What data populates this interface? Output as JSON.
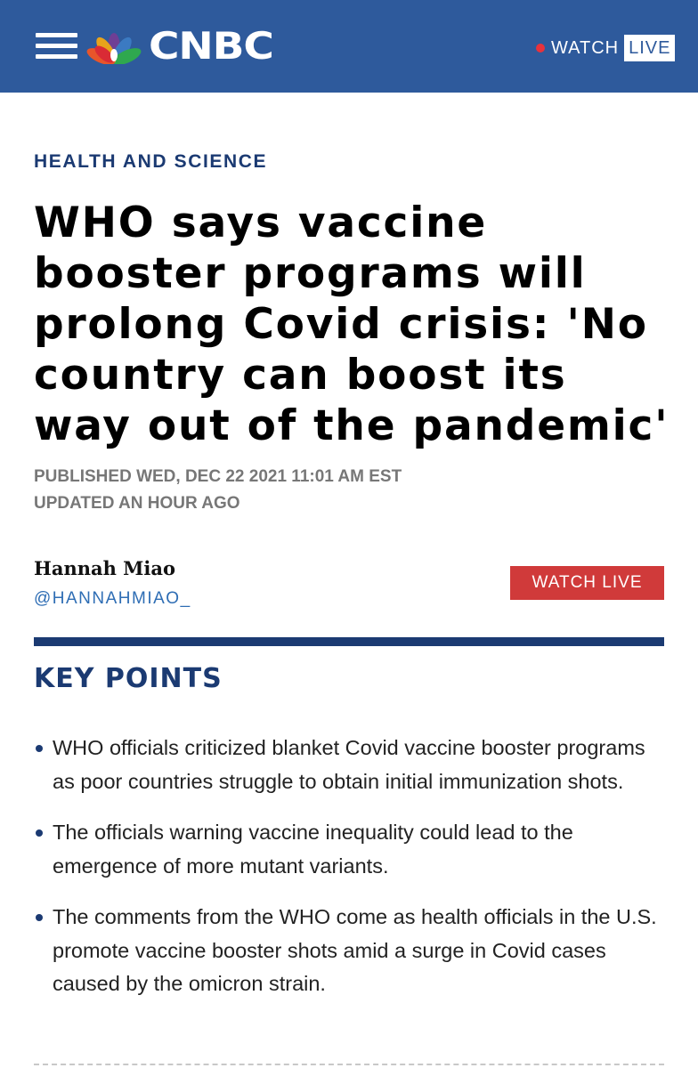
{
  "header": {
    "brand": "CNBC",
    "watch_label": "WATCH",
    "live_label": "LIVE",
    "background_color": "#2e5a9c"
  },
  "article": {
    "section": "HEALTH AND SCIENCE",
    "headline": "WHO says vaccine booster programs will prolong Covid crisis: 'No country can boost its way out of the pandemic'",
    "published": "PUBLISHED WED, DEC 22 2021 11:01 AM EST",
    "updated": "UPDATED AN HOUR AGO",
    "author": {
      "name": "Hannah Miao",
      "handle": "@HANNAHMIAO_"
    },
    "watch_live_button": "WATCH LIVE"
  },
  "key_points": {
    "title": "KEY POINTS",
    "items": [
      "WHO officials criticized blanket Covid vaccine booster programs as poor countries struggle to obtain initial immunization shots.",
      "The officials warning vaccine inequality could lead to the emergence of more mutant variants.",
      "The comments from the WHO come as health officials in the U.S. promote vaccine booster shots amid a surge in Covid cases caused by the omicron strain."
    ]
  },
  "icons": {
    "menu": "hamburger-menu-icon",
    "logo": "peacock-logo-icon",
    "live_indicator": "live-dot-icon",
    "bullet": "bullet-dot-icon"
  },
  "colors": {
    "brand_blue": "#2e5a9c",
    "navy": "#1b3a72",
    "live_red": "#d03a3a",
    "link_blue": "#2e6db4"
  }
}
